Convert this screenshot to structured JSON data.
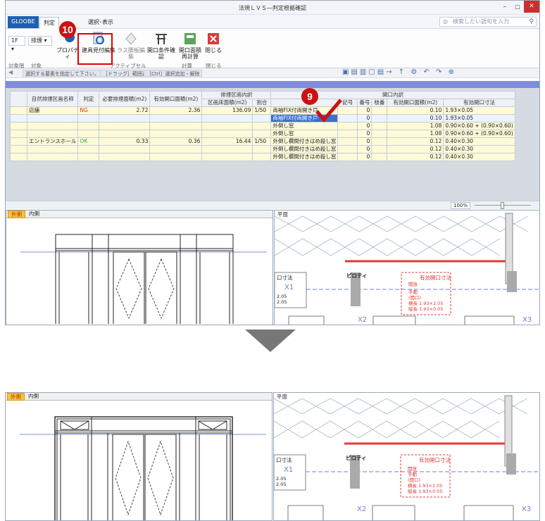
{
  "window": {
    "title": "法規ＬＶＳ―判定根拠確認",
    "min": "–",
    "max": "□",
    "close": "✕"
  },
  "tabs": {
    "file": "GLOOBE",
    "judge": "判定",
    "view": "選択･表示"
  },
  "search": {
    "placeholder": "検索したい語句を入力"
  },
  "ribbon": {
    "floor": "1F ▾",
    "mode": "排煙 ▾",
    "prop": "プロパティ",
    "joinery": "建具見付編集",
    "glass": "ラス腰板編集",
    "cond": "開口条件確認",
    "recalc": "開口面積再計算",
    "close": "閉じる",
    "grp_target": "対象階",
    "grp_obj": "対象",
    "grp_active": "アクティブセル",
    "grp_calc": "計算",
    "grp_close": "閉じる"
  },
  "hints": [
    "選択する要素を指定して下さい。",
    "［ドラッグ］範囲選択",
    "［Ctrl］選択追加・解除"
  ],
  "table": {
    "h_name": "自然排煙区画名称",
    "h_judge": "判定",
    "h_req": "必要排煙面積(m2)",
    "h_eff": "有効開口面積(m2)",
    "h_zone": "排煙区画内訳",
    "h_area": "区画床面積(m2)",
    "h_ratio": "割合",
    "h_open": "開口内訳",
    "h_sym": "記号",
    "h_no": "番号",
    "h_sub": "枝番",
    "h_oeff": "有効開口面積(m2)",
    "h_dim": "有効開口寸法",
    "rows": [
      {
        "name": "店舗",
        "judge": "NG",
        "req": "2.72",
        "eff": "2.36",
        "area": "136.09",
        "ratio": "1/50",
        "type": "両袖FIX付両開き戸",
        "no": "0",
        "oeff": "0.10",
        "dim": "1.93×0.05"
      },
      {
        "name": "",
        "judge": "",
        "req": "",
        "eff": "",
        "area": "",
        "ratio": "",
        "type": "両袖FIX付両開き戸",
        "no": "0",
        "oeff": "0.10",
        "dim": "1.93×0.05"
      },
      {
        "name": "",
        "judge": "",
        "req": "",
        "eff": "",
        "area": "",
        "ratio": "",
        "type": "外倒し窓",
        "no": "0",
        "oeff": "1.08",
        "dim": "0.90×0.60 + (0.90×0.60)"
      },
      {
        "name": "",
        "judge": "",
        "req": "",
        "eff": "",
        "area": "",
        "ratio": "",
        "type": "外倒し窓",
        "no": "0",
        "oeff": "1.08",
        "dim": "0.90×0.60 + (0.90×0.60)"
      },
      {
        "name": "エントランスホール",
        "judge": "OK",
        "req": "0.33",
        "eff": "0.36",
        "area": "16.44",
        "ratio": "1/50",
        "type": "外倒し欄間付きはめ殺し窓",
        "no": "0",
        "oeff": "0.12",
        "dim": "0.40×0.30"
      },
      {
        "name": "",
        "judge": "",
        "req": "",
        "eff": "",
        "area": "",
        "ratio": "",
        "type": "外倒し欄間付きはめ殺し窓",
        "no": "0",
        "oeff": "0.12",
        "dim": "0.40×0.30"
      },
      {
        "name": "",
        "judge": "",
        "req": "",
        "eff": "",
        "area": "",
        "ratio": "",
        "type": "外倒し欄間付きはめ殺し窓",
        "no": "0",
        "oeff": "0.12",
        "dim": "0.40×0.30"
      }
    ]
  },
  "zoom": "100%",
  "panes": {
    "outer": "外側",
    "inner": "内側",
    "plan": "平面",
    "piloti": "ピロティ",
    "eff_label": "有効開口寸法",
    "left_lines": [
      "口寸法",
      "2.05",
      "2.05"
    ],
    "red_lines": [
      "開放",
      "手動",
      "(開口)",
      "横長 1.93×2.05",
      "縦長 1.93×0.05"
    ],
    "grid_x2": "X2",
    "grid_x3": "X3",
    "grid_x1": "X1"
  },
  "badges": {
    "b9": "9",
    "b10": "10"
  }
}
